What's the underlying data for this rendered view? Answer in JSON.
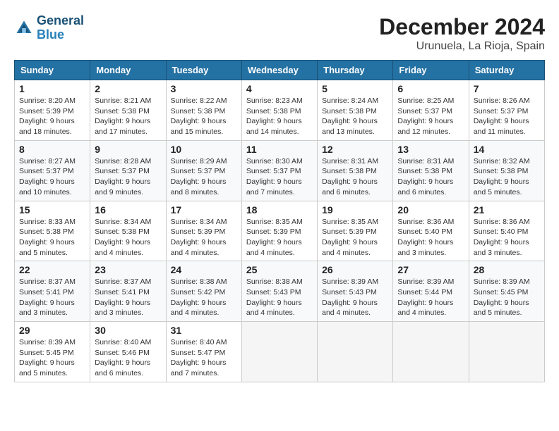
{
  "header": {
    "logo_general": "General",
    "logo_blue": "Blue",
    "title": "December 2024",
    "subtitle": "Urunuela, La Rioja, Spain"
  },
  "calendar": {
    "days_of_week": [
      "Sunday",
      "Monday",
      "Tuesday",
      "Wednesday",
      "Thursday",
      "Friday",
      "Saturday"
    ],
    "weeks": [
      [
        {
          "day": "1",
          "sunrise": "8:20 AM",
          "sunset": "5:39 PM",
          "daylight": "9 hours and 18 minutes."
        },
        {
          "day": "2",
          "sunrise": "8:21 AM",
          "sunset": "5:38 PM",
          "daylight": "9 hours and 17 minutes."
        },
        {
          "day": "3",
          "sunrise": "8:22 AM",
          "sunset": "5:38 PM",
          "daylight": "9 hours and 15 minutes."
        },
        {
          "day": "4",
          "sunrise": "8:23 AM",
          "sunset": "5:38 PM",
          "daylight": "9 hours and 14 minutes."
        },
        {
          "day": "5",
          "sunrise": "8:24 AM",
          "sunset": "5:38 PM",
          "daylight": "9 hours and 13 minutes."
        },
        {
          "day": "6",
          "sunrise": "8:25 AM",
          "sunset": "5:37 PM",
          "daylight": "9 hours and 12 minutes."
        },
        {
          "day": "7",
          "sunrise": "8:26 AM",
          "sunset": "5:37 PM",
          "daylight": "9 hours and 11 minutes."
        }
      ],
      [
        {
          "day": "8",
          "sunrise": "8:27 AM",
          "sunset": "5:37 PM",
          "daylight": "9 hours and 10 minutes."
        },
        {
          "day": "9",
          "sunrise": "8:28 AM",
          "sunset": "5:37 PM",
          "daylight": "9 hours and 9 minutes."
        },
        {
          "day": "10",
          "sunrise": "8:29 AM",
          "sunset": "5:37 PM",
          "daylight": "9 hours and 8 minutes."
        },
        {
          "day": "11",
          "sunrise": "8:30 AM",
          "sunset": "5:37 PM",
          "daylight": "9 hours and 7 minutes."
        },
        {
          "day": "12",
          "sunrise": "8:31 AM",
          "sunset": "5:38 PM",
          "daylight": "9 hours and 6 minutes."
        },
        {
          "day": "13",
          "sunrise": "8:31 AM",
          "sunset": "5:38 PM",
          "daylight": "9 hours and 6 minutes."
        },
        {
          "day": "14",
          "sunrise": "8:32 AM",
          "sunset": "5:38 PM",
          "daylight": "9 hours and 5 minutes."
        }
      ],
      [
        {
          "day": "15",
          "sunrise": "8:33 AM",
          "sunset": "5:38 PM",
          "daylight": "9 hours and 5 minutes."
        },
        {
          "day": "16",
          "sunrise": "8:34 AM",
          "sunset": "5:38 PM",
          "daylight": "9 hours and 4 minutes."
        },
        {
          "day": "17",
          "sunrise": "8:34 AM",
          "sunset": "5:39 PM",
          "daylight": "9 hours and 4 minutes."
        },
        {
          "day": "18",
          "sunrise": "8:35 AM",
          "sunset": "5:39 PM",
          "daylight": "9 hours and 4 minutes."
        },
        {
          "day": "19",
          "sunrise": "8:35 AM",
          "sunset": "5:39 PM",
          "daylight": "9 hours and 4 minutes."
        },
        {
          "day": "20",
          "sunrise": "8:36 AM",
          "sunset": "5:40 PM",
          "daylight": "9 hours and 3 minutes."
        },
        {
          "day": "21",
          "sunrise": "8:36 AM",
          "sunset": "5:40 PM",
          "daylight": "9 hours and 3 minutes."
        }
      ],
      [
        {
          "day": "22",
          "sunrise": "8:37 AM",
          "sunset": "5:41 PM",
          "daylight": "9 hours and 3 minutes."
        },
        {
          "day": "23",
          "sunrise": "8:37 AM",
          "sunset": "5:41 PM",
          "daylight": "9 hours and 3 minutes."
        },
        {
          "day": "24",
          "sunrise": "8:38 AM",
          "sunset": "5:42 PM",
          "daylight": "9 hours and 4 minutes."
        },
        {
          "day": "25",
          "sunrise": "8:38 AM",
          "sunset": "5:43 PM",
          "daylight": "9 hours and 4 minutes."
        },
        {
          "day": "26",
          "sunrise": "8:39 AM",
          "sunset": "5:43 PM",
          "daylight": "9 hours and 4 minutes."
        },
        {
          "day": "27",
          "sunrise": "8:39 AM",
          "sunset": "5:44 PM",
          "daylight": "9 hours and 4 minutes."
        },
        {
          "day": "28",
          "sunrise": "8:39 AM",
          "sunset": "5:45 PM",
          "daylight": "9 hours and 5 minutes."
        }
      ],
      [
        {
          "day": "29",
          "sunrise": "8:39 AM",
          "sunset": "5:45 PM",
          "daylight": "9 hours and 5 minutes."
        },
        {
          "day": "30",
          "sunrise": "8:40 AM",
          "sunset": "5:46 PM",
          "daylight": "9 hours and 6 minutes."
        },
        {
          "day": "31",
          "sunrise": "8:40 AM",
          "sunset": "5:47 PM",
          "daylight": "9 hours and 7 minutes."
        },
        null,
        null,
        null,
        null
      ]
    ]
  }
}
